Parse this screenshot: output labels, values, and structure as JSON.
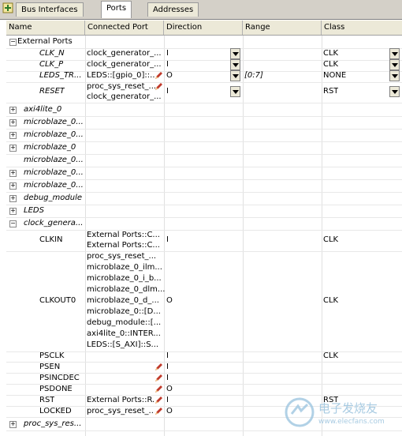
{
  "tabs": [
    {
      "label": "Bus Interfaces"
    },
    {
      "label": "Ports"
    },
    {
      "label": "Addresses"
    }
  ],
  "columns": [
    "Name",
    "Connected Port",
    "Direction",
    "Range",
    "Class"
  ],
  "external_ports": {
    "label": "External Ports",
    "rows": [
      {
        "name": "CLK_N",
        "port": "clock_generator_...",
        "dir": "I",
        "range": "",
        "cls": "CLK"
      },
      {
        "name": "CLK_P",
        "port": "clock_generator_...",
        "dir": "I",
        "range": "",
        "cls": "CLK"
      },
      {
        "name": "LEDS_TR...",
        "port": "LEDS::[gpio_0]::...",
        "dir": "O",
        "range": "[0:7]",
        "cls": "NONE"
      },
      {
        "name": "RESET",
        "port1": "proc_sys_reset_...",
        "port2": "clock_generator_...",
        "dir": "I",
        "range": "",
        "cls": "RST"
      }
    ]
  },
  "instances": [
    "axi4lite_0",
    "microblaze_0...",
    "microblaze_0...",
    "microblaze_0",
    "microblaze_0...",
    "microblaze_0...",
    "microblaze_0...",
    "debug_module",
    "LEDS",
    "clock_genera..."
  ],
  "clock_rows": {
    "clkin": {
      "name": "CLKIN",
      "ports": [
        "External Ports::C...",
        "External Ports::C..."
      ],
      "dir": "I",
      "cls": "CLK"
    },
    "clkout0": {
      "name": "CLKOUT0",
      "ports": [
        "proc_sys_reset_...",
        "microblaze_0_ilm...",
        "microblaze_0_i_b...",
        "microblaze_0_dlm...",
        "microblaze_0_d_...",
        "microblaze_0::[D...",
        "debug_module::[...",
        "axi4lite_0::INTER...",
        "LEDS::[S_AXI]::S..."
      ],
      "dir": "O",
      "cls": "CLK"
    },
    "psclk": {
      "name": "PSCLK",
      "dir": "I",
      "cls": "CLK"
    },
    "psen": {
      "name": "PSEN",
      "dir": "I"
    },
    "psincdec": {
      "name": "PSINCDEC",
      "dir": "I"
    },
    "psdone": {
      "name": "PSDONE",
      "dir": "O"
    },
    "rst": {
      "name": "RST",
      "port": "External Ports::R...",
      "dir": "I",
      "cls": "RST"
    },
    "locked": {
      "name": "LOCKED",
      "port": "proc_sys_reset_...",
      "dir": "O"
    }
  },
  "last_instance": "proc_sys_res...",
  "watermark": {
    "brand": "电子发烧友",
    "url": "www.elecfans.com"
  },
  "colors": {
    "pencil": "#c0392b",
    "tab_bg": "#ece9d8",
    "frame": "#d4d0c8"
  }
}
